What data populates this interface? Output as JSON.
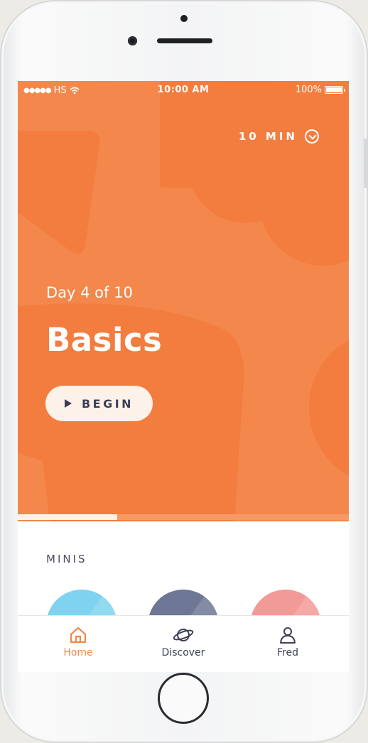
{
  "status_bar": {
    "signal": "●●●●●",
    "carrier": "HS",
    "time": "10:00 AM",
    "battery": "100%"
  },
  "hero": {
    "duration": "10 MIN",
    "day": "Day 4 of 10",
    "title": "Basics",
    "begin_label": "BEGIN",
    "progress": 0.3,
    "background_color": "#f4874b"
  },
  "minis": {
    "label": "MINIS",
    "items": [
      {
        "color": "#7fd3f0"
      },
      {
        "color": "#6f7796"
      },
      {
        "color": "#f29a98"
      }
    ]
  },
  "tabbar": {
    "tabs": [
      {
        "label": "Home",
        "icon": "home-icon",
        "active": true
      },
      {
        "label": "Discover",
        "icon": "planet-icon",
        "active": false
      },
      {
        "label": "Fred",
        "icon": "person-icon",
        "active": false
      }
    ],
    "active_color": "#f4874b",
    "inactive_color": "#3b3f56"
  }
}
